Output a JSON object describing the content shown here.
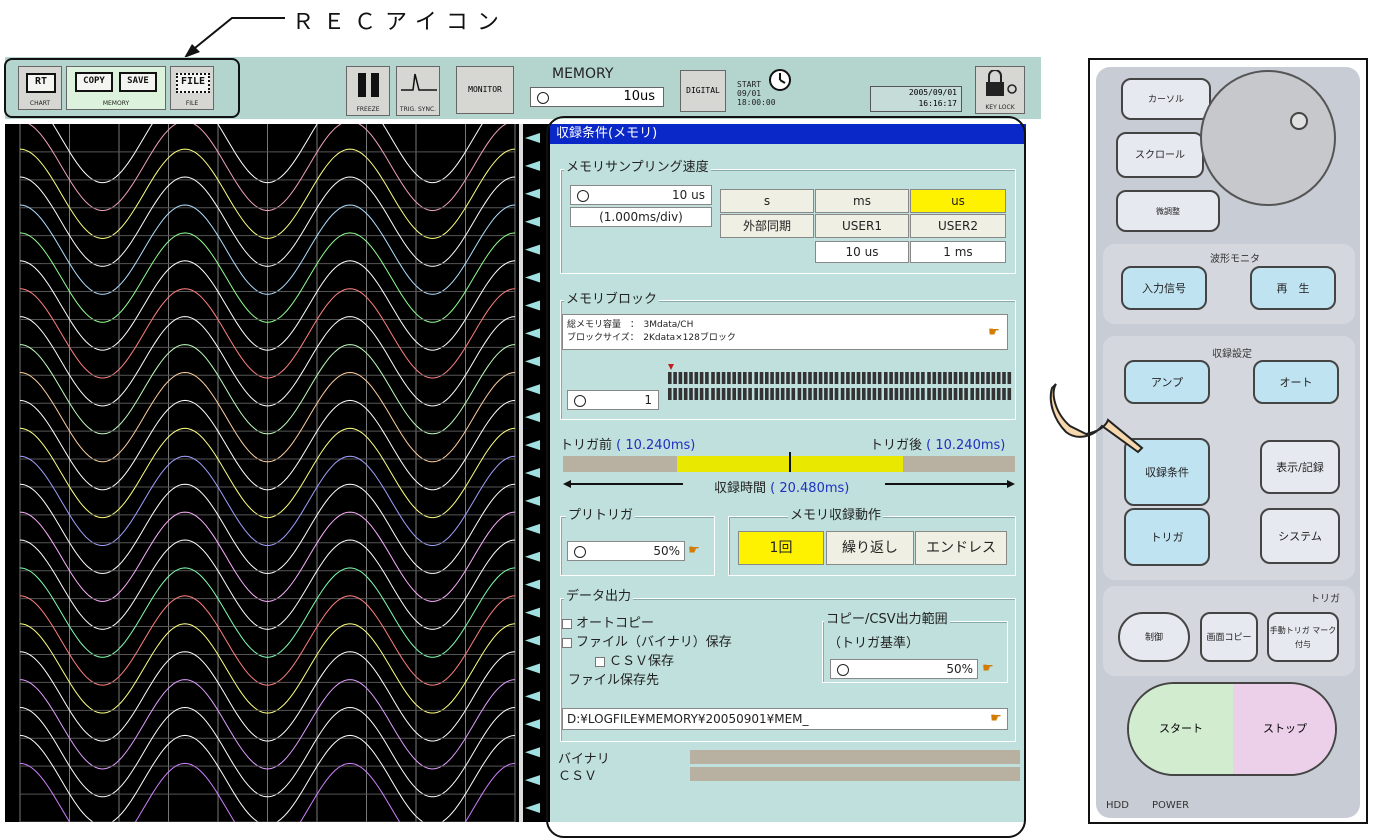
{
  "annotation": {
    "rec_icon_label": "ＲＥＣアイコン"
  },
  "toolbar": {
    "rt_label": "RT",
    "rt_caption": "CHART",
    "copy_label": "COPY",
    "save_label": "SAVE",
    "memory_caption": "MEMORY",
    "file_label": "FILE",
    "file_caption": "FILE",
    "freeze_caption": "FREEZE",
    "trig_caption": "TRIG. SYNC.",
    "monitor_label": "MONITOR",
    "memory_title": "MEMORY",
    "memory_value": "10us",
    "digital_label": "DIGITAL",
    "start_label": "START",
    "start_date": "09/01",
    "start_time": "18:00:00",
    "clock_date": "2005/09/01",
    "clock_time": "16:16:17",
    "keylock_caption": "KEY LOCK"
  },
  "settings": {
    "title": "収録条件(メモリ)",
    "sampling": {
      "title": "メモリサンプリング速度",
      "value": "10 us",
      "per_div": "(1.000ms/div)",
      "units": [
        "s",
        "ms",
        "us"
      ],
      "selected_unit": "us",
      "external": "外部同期",
      "user1": "USER1",
      "user2": "USER2",
      "user1_value": "10 us",
      "user2_value": "1 ms"
    },
    "block": {
      "title": "メモリブロック",
      "line1": "総メモリ容量　：　3Mdata/CH",
      "line2": "ブロックサイズ：　2Kdata×128ブロック",
      "block_value": "1"
    },
    "trigger_range": {
      "pre_label": "トリガ前",
      "pre_value": "( 10.240ms)",
      "post_label": "トリガ後",
      "post_value": "( 10.240ms)",
      "total_label": "収録時間",
      "total_value": "( 20.480ms)",
      "pre_fraction": 0.5
    },
    "pretrigger": {
      "title": "プリトリガ",
      "value": "50%"
    },
    "record_mode": {
      "title": "メモリ収録動作",
      "options": [
        "1回",
        "繰り返し",
        "エンドレス"
      ],
      "selected": "1回"
    },
    "data_output": {
      "title": "データ出力",
      "auto_copy": "オートコピー",
      "file_save": "ファイル（バイナリ）保存",
      "csv_save": "ＣＳＶ保存",
      "dest_label": "ファイル保存先",
      "path": "D:¥LOGFILE¥MEMORY¥20050901¥MEM_",
      "range_title": "コピー/CSV出力範囲",
      "range_basis": "（トリガ基準）",
      "range_value": "50%"
    },
    "progress": {
      "binary_label": "バイナリ",
      "csv_label": "ＣＳＶ"
    }
  },
  "waveforms": {
    "colors": [
      "#ffffff",
      "#f0a0c0",
      "#ffff80",
      "#ffffff",
      "#b0e0ff",
      "#90ff90",
      "#ffffff",
      "#ff8080",
      "#ffffff",
      "#c0ffc0",
      "#ffd0a0",
      "#ffffff",
      "#ffff80",
      "#a0a0ff",
      "#ffffff",
      "#ffb0ff",
      "#ffffff",
      "#80ffb0",
      "#ff8080",
      "#ffff80",
      "#ffffff",
      "#e0a0ff",
      "#ffffff",
      "#ffffff",
      "#d080ff"
    ],
    "periods": 3
  },
  "remote": {
    "cursor": "カーソル",
    "scroll": "スクロール",
    "fine": "微調整",
    "monitor_section": "波形モニタ",
    "input_signal": "入力信号",
    "playback": "再　生",
    "record_section": "収録設定",
    "amp": "アンプ",
    "auto": "オート",
    "record_cond": "収録条件",
    "display": "表示/記録",
    "trigger": "トリガ",
    "system": "システム",
    "trigger_section": "トリガ",
    "ctrl": "制御",
    "screen_copy": "画面コピー",
    "manual_trig": "手動トリガ マーク付与",
    "start": "スタート",
    "stop": "ストップ",
    "hdd": "HDD",
    "power": "POWER"
  }
}
